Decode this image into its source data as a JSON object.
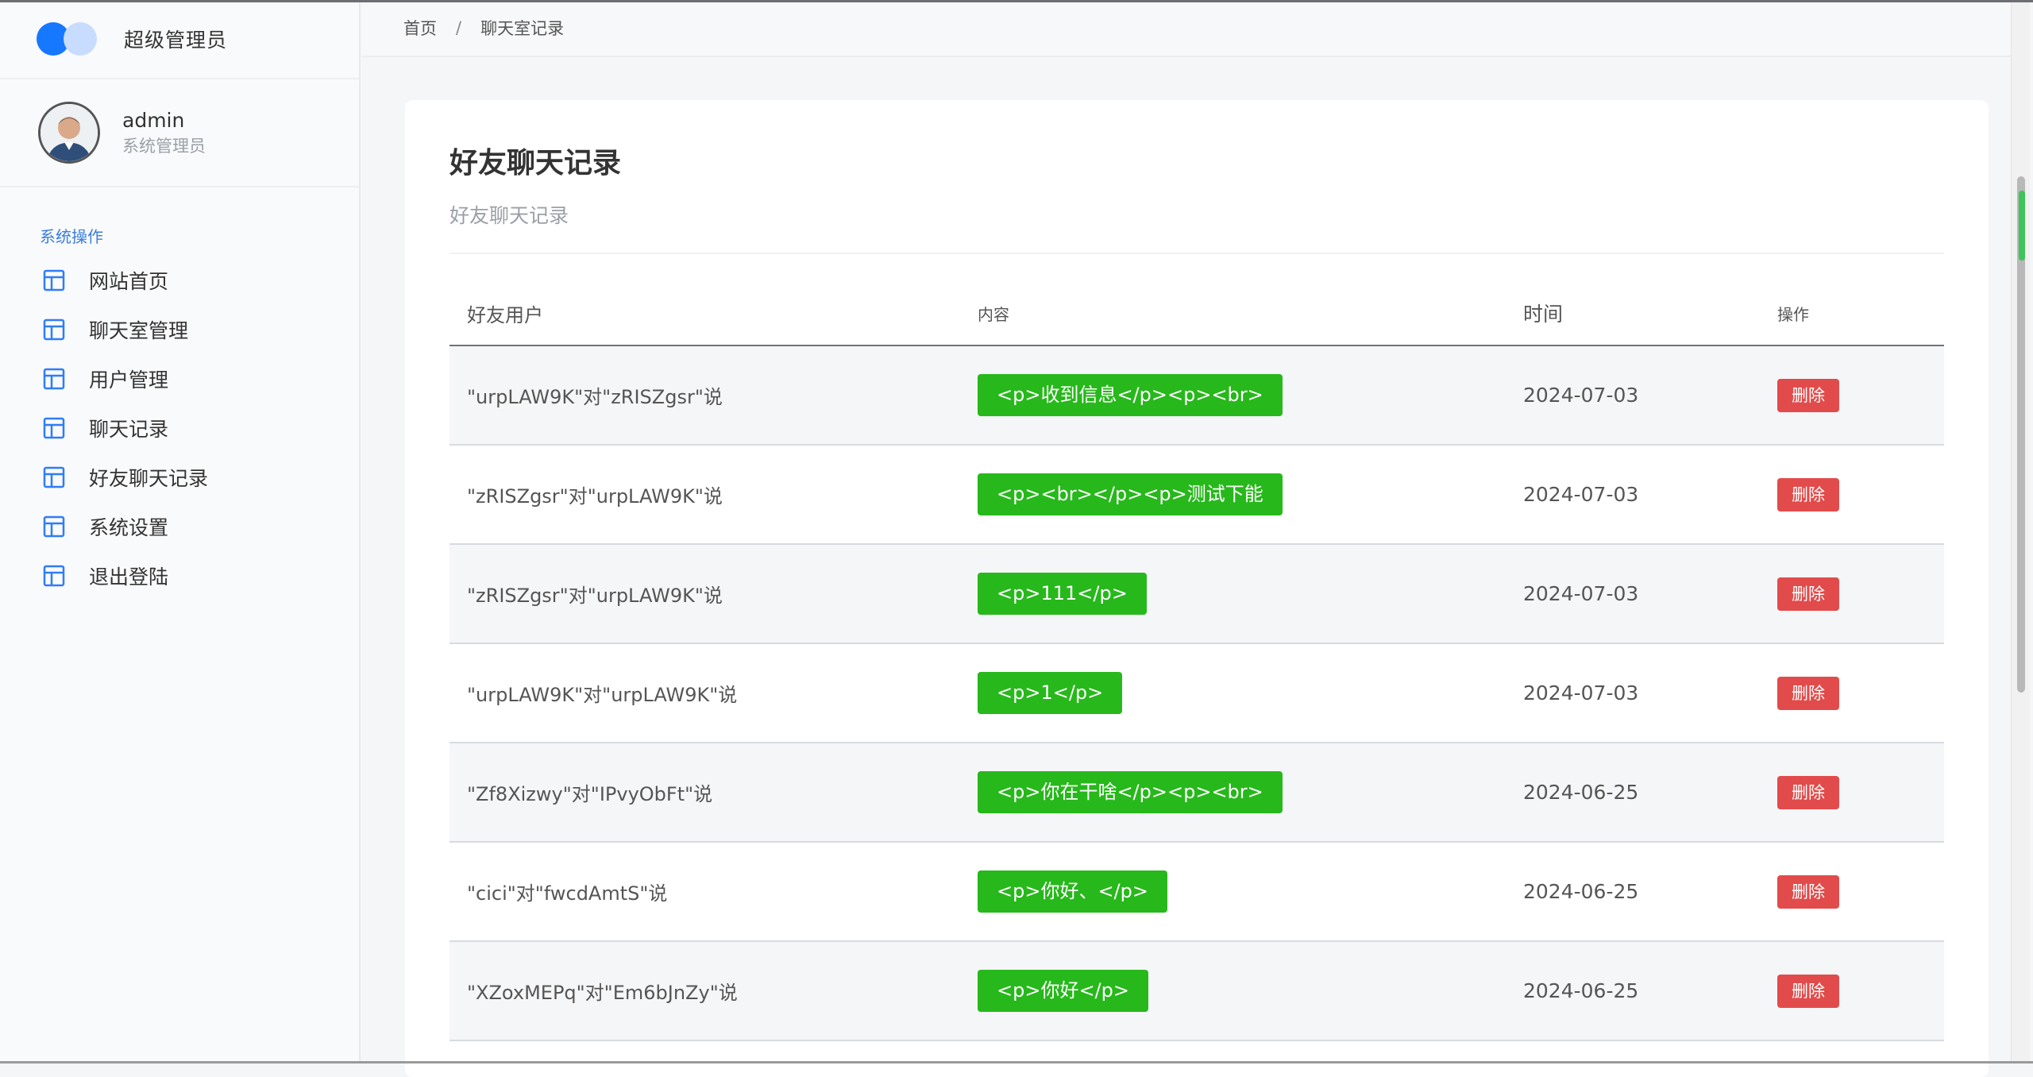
{
  "brand": {
    "title": "超级管理员",
    "colors": {
      "primary": "#1677ff",
      "secondary": "#c8dcff"
    }
  },
  "user": {
    "name": "admin",
    "role": "系统管理员"
  },
  "nav": {
    "section": "系统操作",
    "items": [
      {
        "label": "网站首页",
        "icon": "layout-icon"
      },
      {
        "label": "聊天室管理",
        "icon": "layout-icon"
      },
      {
        "label": "用户管理",
        "icon": "layout-icon"
      },
      {
        "label": "聊天记录",
        "icon": "layout-icon"
      },
      {
        "label": "好友聊天记录",
        "icon": "layout-icon"
      },
      {
        "label": "系统设置",
        "icon": "layout-icon"
      },
      {
        "label": "退出登陆",
        "icon": "layout-icon"
      }
    ]
  },
  "breadcrumb": {
    "home": "首页",
    "separator": "/",
    "current": "聊天室记录"
  },
  "page": {
    "title": "好友聊天记录",
    "subtitle": "好友聊天记录"
  },
  "table": {
    "headers": {
      "user": "好友用户",
      "content": "内容",
      "time": "时间",
      "op": "操作"
    },
    "rows": [
      {
        "user": "\"urpLAW9K\"对\"zRISZgsr\"说",
        "content": "<p>收到信息</p><p><br>",
        "time": "2024-07-03",
        "op": "删除"
      },
      {
        "user": "\"zRISZgsr\"对\"urpLAW9K\"说",
        "content": "<p><br></p><p>测试下能",
        "time": "2024-07-03",
        "op": "删除"
      },
      {
        "user": "\"zRISZgsr\"对\"urpLAW9K\"说",
        "content": "<p>111</p>",
        "time": "2024-07-03",
        "op": "删除"
      },
      {
        "user": "\"urpLAW9K\"对\"urpLAW9K\"说",
        "content": "<p>1</p>",
        "time": "2024-07-03",
        "op": "删除"
      },
      {
        "user": "\"Zf8Xizwy\"对\"IPvyObFt\"说",
        "content": "<p>你在干啥</p><p><br>",
        "time": "2024-06-25",
        "op": "删除"
      },
      {
        "user": "\"cici\"对\"fwcdAmtS\"说",
        "content": "<p>你好、</p>",
        "time": "2024-06-25",
        "op": "删除"
      },
      {
        "user": "\"XZoxMEPq\"对\"Em6bJnZy\"说",
        "content": "<p>你好</p>",
        "time": "2024-06-25",
        "op": "删除"
      }
    ]
  },
  "colors": {
    "content_pill": "#27b81b",
    "delete_button": "#e24b4b",
    "nav_section": "#3b7ddd"
  }
}
